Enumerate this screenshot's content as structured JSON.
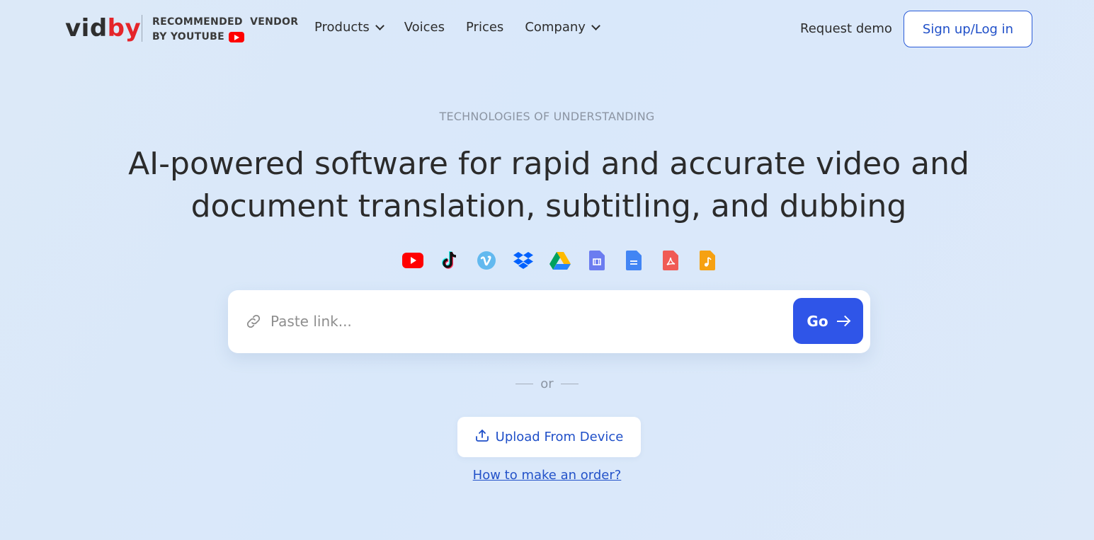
{
  "header": {
    "logo": {
      "part1": "vid",
      "part2": "by"
    },
    "vendor_line1": "RECOMMENDED  VENDOR",
    "vendor_line2": "BY YOUTUBE",
    "nav": [
      {
        "label": "Products",
        "has_dropdown": true
      },
      {
        "label": "Voices",
        "has_dropdown": false
      },
      {
        "label": "Prices",
        "has_dropdown": false
      },
      {
        "label": "Company",
        "has_dropdown": true
      }
    ],
    "request_demo": "Request demo",
    "signup_label": "Sign up/Log in"
  },
  "hero": {
    "eyebrow": "TECHNOLOGIES OF UNDERSTANDING",
    "headline_line1": "AI-powered software for rapid and accurate video and",
    "headline_line2": "document translation, subtitling, and dubbing"
  },
  "sources": [
    "youtube-icon",
    "tiktok-icon",
    "vimeo-icon",
    "dropbox-icon",
    "google-drive-icon",
    "video-file-icon",
    "document-file-icon",
    "pdf-file-icon",
    "audio-file-icon"
  ],
  "link_input": {
    "placeholder": "Paste link...",
    "value": ""
  },
  "go_label": "Go",
  "or_text": "or",
  "upload_label": "Upload From Device",
  "howto_link": "How to make an order?",
  "colors": {
    "brand_red": "#e5252a",
    "primary_blue": "#2f55e8",
    "link_blue": "#1f4fc8",
    "background": "#dae8f9"
  }
}
